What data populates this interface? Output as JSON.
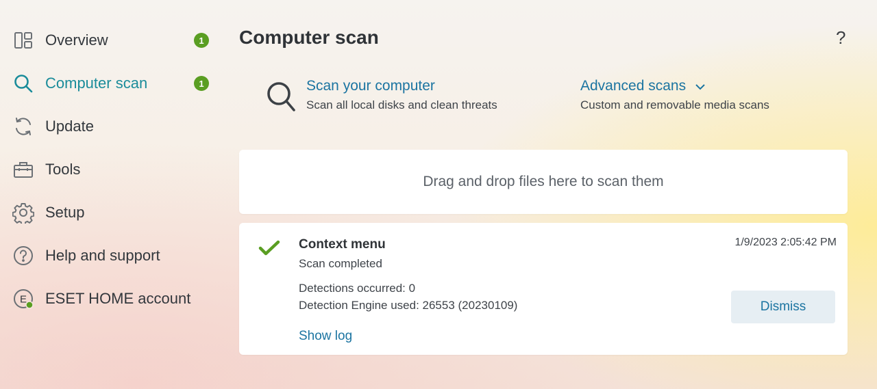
{
  "sidebar": {
    "items": [
      {
        "label": "Overview",
        "icon": "overview-icon",
        "badge": "1"
      },
      {
        "label": "Computer scan",
        "icon": "search-icon",
        "badge": "1",
        "active": true
      },
      {
        "label": "Update",
        "icon": "refresh-icon"
      },
      {
        "label": "Tools",
        "icon": "toolbox-icon"
      },
      {
        "label": "Setup",
        "icon": "gear-icon"
      },
      {
        "label": "Help and support",
        "icon": "help-circle-icon"
      },
      {
        "label": "ESET HOME account",
        "icon": "eset-home-icon",
        "icon_letter": "E"
      }
    ]
  },
  "main": {
    "title": "Computer scan",
    "help": "?",
    "scan_your_computer": {
      "title": "Scan your computer",
      "desc": "Scan all local disks and clean threats"
    },
    "advanced_scans": {
      "title": "Advanced scans",
      "desc": "Custom and removable media scans"
    },
    "drop_zone": "Drag and drop files here to scan them",
    "result": {
      "title": "Context menu",
      "status": "Scan completed",
      "detections": "Detections occurred: 0",
      "engine": "Detection Engine used: 26553 (20230109)",
      "date": "1/9/2023 2:05:42 PM",
      "show_log": "Show log",
      "dismiss": "Dismiss"
    }
  },
  "colors": {
    "accent": "#1b74a1",
    "active": "#1a8c9a",
    "badge": "#5a9e22",
    "success": "#5a9e22"
  }
}
